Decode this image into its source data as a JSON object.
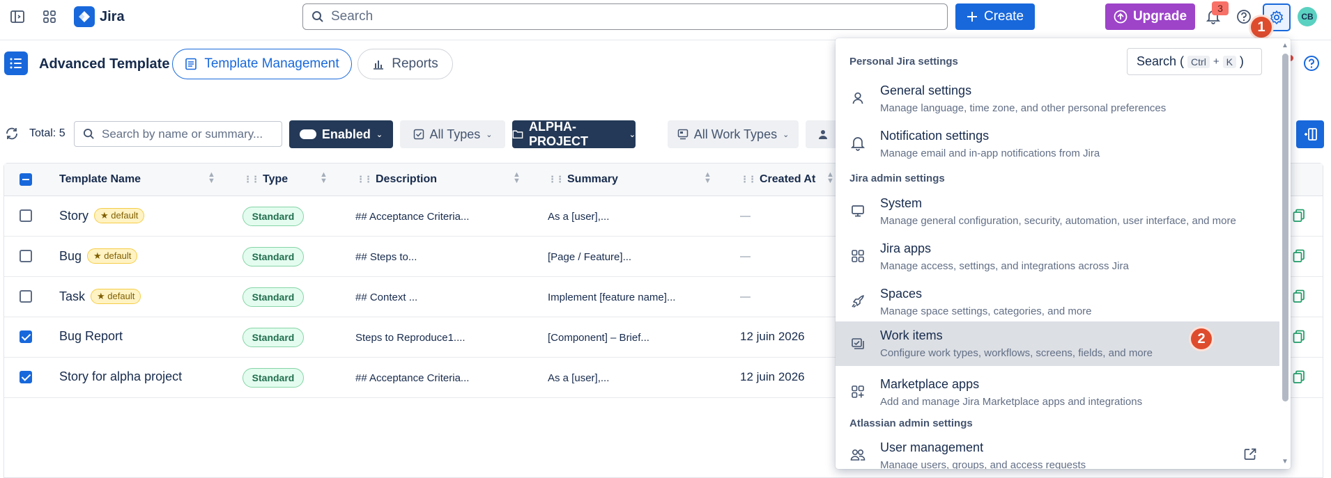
{
  "topbar": {
    "product": "Jira",
    "search_placeholder": "Search",
    "create_label": "Create",
    "upgrade_label": "Upgrade",
    "notifications_count": "3",
    "avatar_initials": "CB",
    "step1": "1"
  },
  "app": {
    "title": "Advanced Template",
    "tabs": [
      {
        "label": "Template Management"
      },
      {
        "label": "Reports"
      }
    ]
  },
  "filters": {
    "total": "Total: 5",
    "search_placeholder": "Search by name or summary...",
    "enabled": "Enabled",
    "all_types": "All Types",
    "project": "ALPHA-PROJECT",
    "all_work_types": "All Work Types"
  },
  "table": {
    "headers": [
      "Template Name",
      "Type",
      "Description",
      "Summary",
      "Created At"
    ],
    "rows": [
      {
        "name": "Story",
        "default": "★ default",
        "type": "Standard",
        "description": "## Acceptance Criteria...",
        "summary": "As a [user],...",
        "created": "—",
        "checked": false
      },
      {
        "name": "Bug",
        "default": "★ default",
        "type": "Standard",
        "description": "## Steps to...",
        "summary": "[Page / Feature]...",
        "created": "—",
        "checked": false
      },
      {
        "name": "Task",
        "default": "★ default",
        "type": "Standard",
        "description": "## Context ...",
        "summary": "Implement [feature name]...",
        "created": "—",
        "checked": false
      },
      {
        "name": "Bug Report",
        "default": "",
        "type": "Standard",
        "description": "Steps to Reproduce1....",
        "summary": "[Component] – Brief...",
        "created": "12 juin 2026",
        "checked": true
      },
      {
        "name": "Story for alpha project",
        "default": "",
        "type": "Standard",
        "description": "## Acceptance Criteria...",
        "summary": "As a [user],...",
        "created": "12 juin 2026",
        "checked": true
      }
    ]
  },
  "settings_menu": {
    "personal_heading": "Personal Jira settings",
    "search_label": "Search (",
    "search_key1": "Ctrl",
    "search_plus": "+",
    "search_key2": "K",
    "search_close": ")",
    "admin_heading": "Jira admin settings",
    "atlassian_heading": "Atlassian admin settings",
    "step2": "2",
    "items": [
      {
        "title": "General settings",
        "desc": "Manage language, time zone, and other personal preferences",
        "icon": "person-icon"
      },
      {
        "title": "Notification settings",
        "desc": "Manage email and in-app notifications from Jira",
        "icon": "bell-icon"
      },
      {
        "title": "System",
        "desc": "Manage general configuration, security, automation, user interface, and more",
        "icon": "monitor-icon"
      },
      {
        "title": "Jira apps",
        "desc": "Manage access, settings, and integrations across Jira",
        "icon": "apps-grid-icon"
      },
      {
        "title": "Spaces",
        "desc": "Manage space settings, categories, and more",
        "icon": "rocket-icon"
      },
      {
        "title": "Work items",
        "desc": "Configure work types, workflows, screens, fields, and more",
        "icon": "work-items-icon"
      },
      {
        "title": "Marketplace apps",
        "desc": "Add and manage Jira Marketplace apps and integrations",
        "icon": "marketplace-icon"
      },
      {
        "title": "User management",
        "desc": "Manage users, groups, and access requests",
        "icon": "people-icon"
      }
    ]
  },
  "colors": {
    "brand": "#1868db",
    "upgrade": "#9d44c9",
    "step_badge": "#de4c2e",
    "dark_filter": "#243957"
  }
}
